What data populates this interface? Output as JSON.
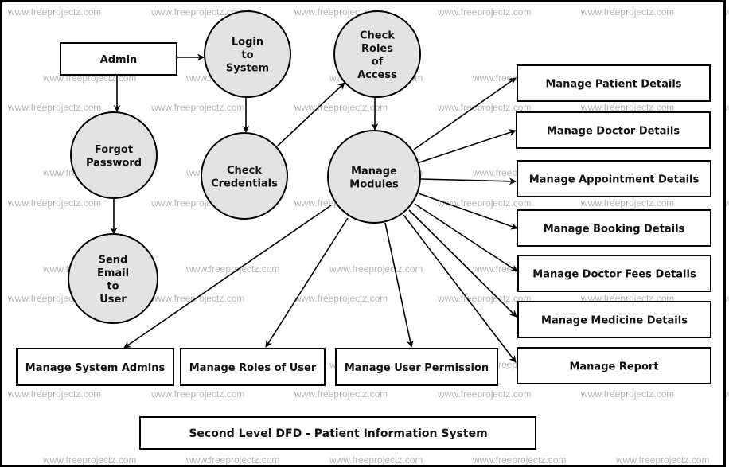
{
  "title": "Second Level DFD - Patient Information System",
  "watermark": "www.freeprojectz.com",
  "colors": {
    "process_fill": "#e3e3e3",
    "entity_fill": "#ffffff",
    "stroke": "#000000",
    "watermark": "#b8b8b8"
  },
  "entities": [
    {
      "id": "admin",
      "label": "Admin"
    },
    {
      "id": "patient",
      "label": "Manage Patient Details"
    },
    {
      "id": "doctor",
      "label": "Manage Doctor Details"
    },
    {
      "id": "appointment",
      "label": "Manage Appointment Details"
    },
    {
      "id": "booking",
      "label": "Manage Booking Details"
    },
    {
      "id": "fees",
      "label": "Manage Doctor Fees Details"
    },
    {
      "id": "medicine",
      "label": "Manage Medicine Details"
    },
    {
      "id": "report",
      "label": "Manage Report"
    },
    {
      "id": "sysadmins",
      "label": "Manage System Admins"
    },
    {
      "id": "roles",
      "label": "Manage Roles of User"
    },
    {
      "id": "permission",
      "label": "Manage User Permission"
    }
  ],
  "processes": [
    {
      "id": "login",
      "lines": [
        "Login",
        "to",
        "System"
      ]
    },
    {
      "id": "checkroles",
      "lines": [
        "Check",
        "Roles",
        "of",
        "Access"
      ]
    },
    {
      "id": "forgot",
      "lines": [
        "Forgot",
        "Password"
      ]
    },
    {
      "id": "credentials",
      "lines": [
        "Check",
        "Credentials"
      ]
    },
    {
      "id": "modules",
      "lines": [
        "Manage",
        "Modules"
      ]
    },
    {
      "id": "email",
      "lines": [
        "Send",
        "Email",
        "to",
        "User"
      ]
    }
  ],
  "flows": [
    {
      "from": "admin",
      "to": "login"
    },
    {
      "from": "admin",
      "to": "forgot"
    },
    {
      "from": "login",
      "to": "credentials"
    },
    {
      "from": "credentials",
      "to": "checkroles"
    },
    {
      "from": "checkroles",
      "to": "modules"
    },
    {
      "from": "forgot",
      "to": "email"
    },
    {
      "from": "modules",
      "to": "patient"
    },
    {
      "from": "modules",
      "to": "doctor"
    },
    {
      "from": "modules",
      "to": "appointment"
    },
    {
      "from": "modules",
      "to": "booking"
    },
    {
      "from": "modules",
      "to": "fees"
    },
    {
      "from": "modules",
      "to": "medicine"
    },
    {
      "from": "modules",
      "to": "report"
    },
    {
      "from": "modules",
      "to": "sysadmins"
    },
    {
      "from": "modules",
      "to": "roles"
    },
    {
      "from": "modules",
      "to": "permission"
    }
  ]
}
